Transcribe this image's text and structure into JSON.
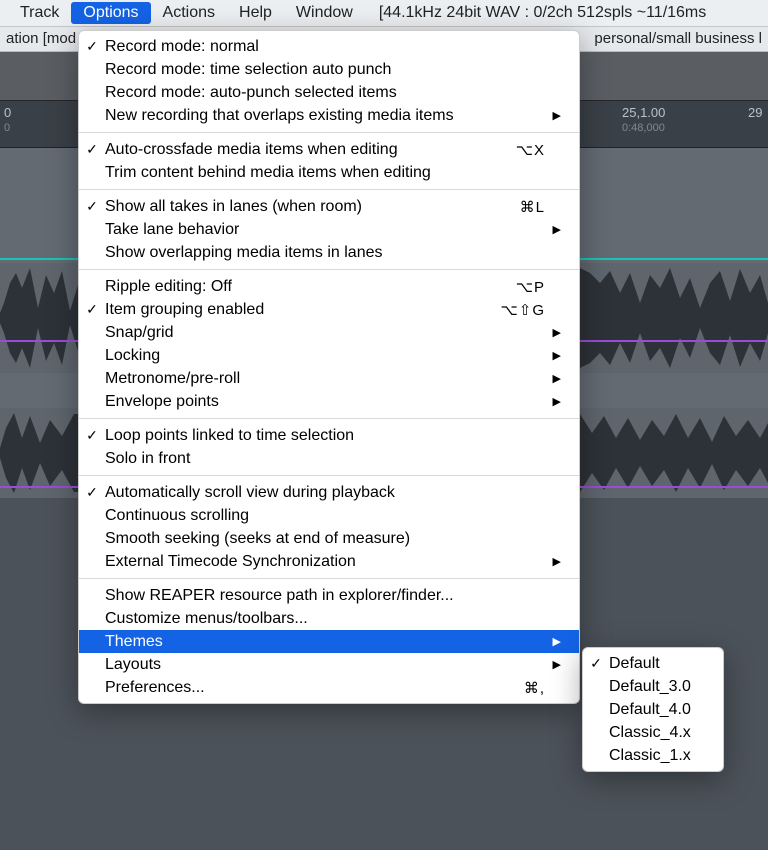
{
  "menubar": {
    "items": [
      "Track",
      "Options",
      "Actions",
      "Help",
      "Window"
    ],
    "active_index": 1,
    "status": "[44.1kHz 24bit WAV : 0/2ch 512spls ~11/16ms"
  },
  "infobar": {
    "left": "ation [mod",
    "right": "personal/small business l"
  },
  "timeline": {
    "marks": [
      "0",
      "25,1.00",
      "29"
    ],
    "subs": [
      "0",
      "0:48,000"
    ]
  },
  "options_menu": {
    "groups": [
      [
        {
          "label": "Record mode: normal",
          "checked": true
        },
        {
          "label": "Record mode: time selection auto punch"
        },
        {
          "label": "Record mode: auto-punch selected items"
        },
        {
          "label": "New recording that overlaps existing media items",
          "submenu": true
        }
      ],
      [
        {
          "label": "Auto-crossfade media items when editing",
          "checked": true,
          "shortcut": "⌥X"
        },
        {
          "label": "Trim content behind media items when editing"
        }
      ],
      [
        {
          "label": "Show all takes in lanes (when room)",
          "checked": true,
          "shortcut": "⌘L"
        },
        {
          "label": "Take lane behavior",
          "submenu": true
        },
        {
          "label": "Show overlapping media items in lanes"
        }
      ],
      [
        {
          "label": "Ripple editing: Off",
          "shortcut": "⌥P"
        },
        {
          "label": "Item grouping enabled",
          "checked": true,
          "shortcut": "⌥⇧G"
        },
        {
          "label": "Snap/grid",
          "submenu": true
        },
        {
          "label": "Locking",
          "submenu": true
        },
        {
          "label": "Metronome/pre-roll",
          "submenu": true
        },
        {
          "label": "Envelope points",
          "submenu": true
        }
      ],
      [
        {
          "label": "Loop points linked to time selection",
          "checked": true
        },
        {
          "label": "Solo in front"
        }
      ],
      [
        {
          "label": "Automatically scroll view during playback",
          "checked": true
        },
        {
          "label": "Continuous scrolling"
        },
        {
          "label": "Smooth seeking (seeks at end of measure)"
        },
        {
          "label": "External Timecode Synchronization",
          "submenu": true
        }
      ],
      [
        {
          "label": "Show REAPER resource path in explorer/finder..."
        },
        {
          "label": "Customize menus/toolbars..."
        },
        {
          "label": "Themes",
          "submenu": true,
          "highlighted": true
        },
        {
          "label": "Layouts",
          "submenu": true
        },
        {
          "label": "Preferences...",
          "shortcut": "⌘,"
        }
      ]
    ]
  },
  "themes_submenu": [
    {
      "label": "Default",
      "checked": true
    },
    {
      "label": "Default_3.0"
    },
    {
      "label": "Default_4.0"
    },
    {
      "label": "Classic_4.x"
    },
    {
      "label": "Classic_1.x"
    }
  ]
}
